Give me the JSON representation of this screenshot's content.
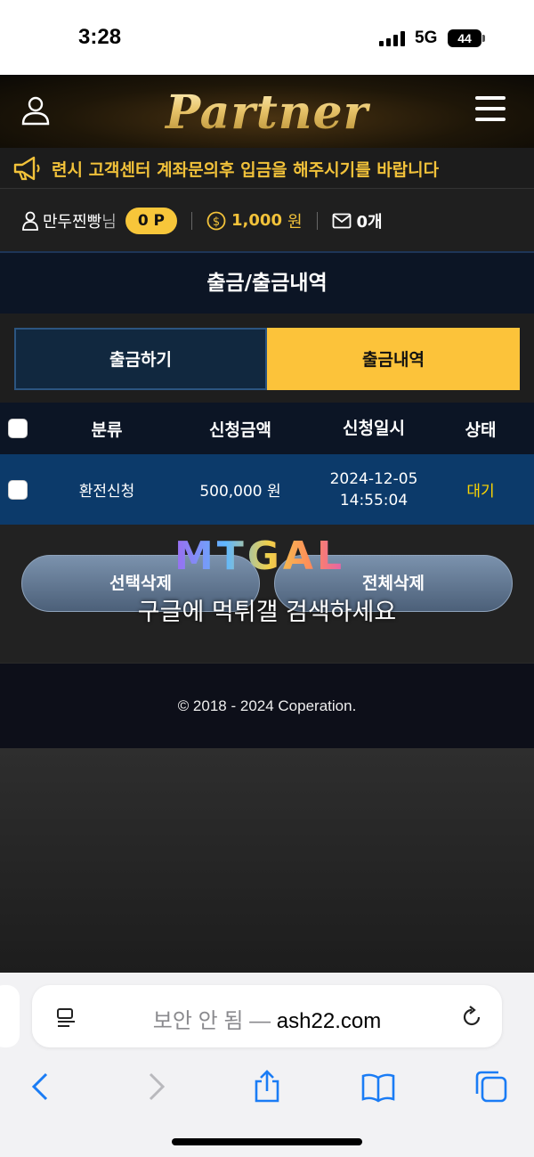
{
  "status_bar": {
    "time": "3:28",
    "network": "5G",
    "battery": "44"
  },
  "header": {
    "logo": "Partner"
  },
  "notice": {
    "text": "련시 고객센터 계좌문의후 입금을 해주시기를 바랍니다"
  },
  "user_info": {
    "username": "만두찐빵",
    "suffix": "님",
    "points": "0 P",
    "money": "1,000",
    "money_unit": "원",
    "messages": "0개"
  },
  "page": {
    "title": "출금/출금내역"
  },
  "tabs": [
    {
      "label": "출금하기",
      "active": false
    },
    {
      "label": "출금내역",
      "active": true
    }
  ],
  "table": {
    "headers": [
      "분류",
      "신청금액",
      "신청일시",
      "상태"
    ],
    "rows": [
      {
        "category": "환전신청",
        "amount": "500,000 원",
        "date": "2024-12-05",
        "time": "14:55:04",
        "status": "대기"
      }
    ]
  },
  "actions": {
    "delete_selected": "선택삭제",
    "delete_all": "전체삭제"
  },
  "watermark": {
    "logo": "MTGAL",
    "text": "구글에 먹튀갤 검색하세요"
  },
  "footer": {
    "copyright": "© 2018 - 2024 Coperation."
  },
  "browser": {
    "insecure_label": "보안 안 됨 —",
    "host": "ash22.com"
  },
  "colors": {
    "accent": "#fcc33a",
    "header_bg": "#0c1525",
    "row_bg": "#0c3a6a",
    "status_wait": "#ffd600"
  }
}
